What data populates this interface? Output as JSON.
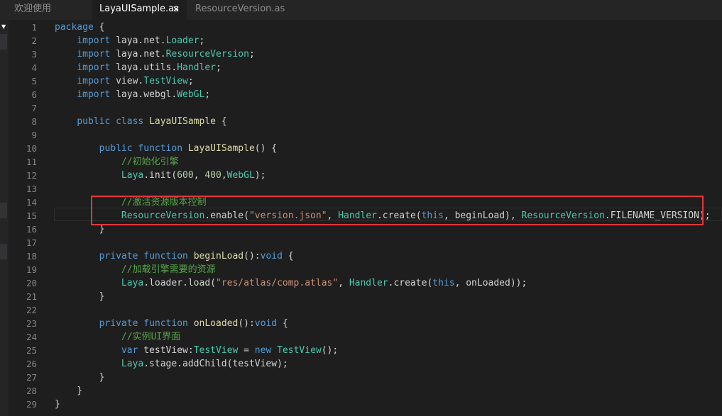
{
  "tabs": [
    {
      "label": "欢迎使用",
      "active": false
    },
    {
      "label": "LayaUISample.as",
      "active": true
    },
    {
      "label": "ResourceVersion.as",
      "active": false
    }
  ],
  "tab_close_glyph": "✕",
  "gutter_arrow": "▼",
  "colors": {
    "background": "#1e1e1e",
    "tab_bar": "#252526",
    "keyword": "#569cd6",
    "type": "#4ec9b0",
    "function": "#dcdcaa",
    "string": "#ce9178",
    "number": "#b5cea8",
    "comment": "#57a64a",
    "highlight_box": "#e2383b"
  },
  "current_line": 15,
  "highlighted_lines": [
    14,
    15
  ],
  "lines": [
    {
      "n": "1",
      "tokens": [
        {
          "t": "kw",
          "v": "package"
        },
        {
          "t": "plain",
          "v": " {"
        }
      ]
    },
    {
      "n": "2",
      "tokens": [
        {
          "t": "plain",
          "v": "    "
        },
        {
          "t": "kw",
          "v": "import"
        },
        {
          "t": "plain",
          "v": " laya.net."
        },
        {
          "t": "type",
          "v": "Loader"
        },
        {
          "t": "plain",
          "v": ";"
        }
      ]
    },
    {
      "n": "3",
      "tokens": [
        {
          "t": "plain",
          "v": "    "
        },
        {
          "t": "kw",
          "v": "import"
        },
        {
          "t": "plain",
          "v": " laya.net."
        },
        {
          "t": "type",
          "v": "ResourceVersion"
        },
        {
          "t": "plain",
          "v": ";"
        }
      ]
    },
    {
      "n": "4",
      "tokens": [
        {
          "t": "plain",
          "v": "    "
        },
        {
          "t": "kw",
          "v": "import"
        },
        {
          "t": "plain",
          "v": " laya.utils."
        },
        {
          "t": "type",
          "v": "Handler"
        },
        {
          "t": "plain",
          "v": ";"
        }
      ]
    },
    {
      "n": "5",
      "tokens": [
        {
          "t": "plain",
          "v": "    "
        },
        {
          "t": "kw",
          "v": "import"
        },
        {
          "t": "plain",
          "v": " view."
        },
        {
          "t": "type",
          "v": "TestView"
        },
        {
          "t": "plain",
          "v": ";"
        }
      ]
    },
    {
      "n": "6",
      "tokens": [
        {
          "t": "plain",
          "v": "    "
        },
        {
          "t": "kw",
          "v": "import"
        },
        {
          "t": "plain",
          "v": " laya.webgl."
        },
        {
          "t": "type",
          "v": "WebGL"
        },
        {
          "t": "plain",
          "v": ";"
        }
      ]
    },
    {
      "n": "7",
      "tokens": []
    },
    {
      "n": "8",
      "tokens": [
        {
          "t": "plain",
          "v": "    "
        },
        {
          "t": "kw",
          "v": "public class"
        },
        {
          "t": "plain",
          "v": " "
        },
        {
          "t": "fn",
          "v": "LayaUISample"
        },
        {
          "t": "plain",
          "v": " {"
        }
      ]
    },
    {
      "n": "9",
      "tokens": []
    },
    {
      "n": "10",
      "tokens": [
        {
          "t": "plain",
          "v": "        "
        },
        {
          "t": "kw",
          "v": "public function"
        },
        {
          "t": "plain",
          "v": " "
        },
        {
          "t": "fn",
          "v": "LayaUISample"
        },
        {
          "t": "plain",
          "v": "() {"
        }
      ]
    },
    {
      "n": "11",
      "tokens": [
        {
          "t": "plain",
          "v": "            "
        },
        {
          "t": "comment",
          "v": "//初始化引擎"
        }
      ]
    },
    {
      "n": "12",
      "tokens": [
        {
          "t": "plain",
          "v": "            "
        },
        {
          "t": "type",
          "v": "Laya"
        },
        {
          "t": "plain",
          "v": ".init("
        },
        {
          "t": "num",
          "v": "600"
        },
        {
          "t": "plain",
          "v": ", "
        },
        {
          "t": "num",
          "v": "400"
        },
        {
          "t": "plain",
          "v": ","
        },
        {
          "t": "type",
          "v": "WebGL"
        },
        {
          "t": "plain",
          "v": ");"
        }
      ]
    },
    {
      "n": "13",
      "tokens": []
    },
    {
      "n": "14",
      "tokens": [
        {
          "t": "plain",
          "v": "            "
        },
        {
          "t": "comment",
          "v": "//激活资源版本控制"
        }
      ]
    },
    {
      "n": "15",
      "tokens": [
        {
          "t": "plain",
          "v": "            "
        },
        {
          "t": "type",
          "v": "ResourceVersion"
        },
        {
          "t": "plain",
          "v": ".enable("
        },
        {
          "t": "str",
          "v": "\"version.json\""
        },
        {
          "t": "plain",
          "v": ", "
        },
        {
          "t": "type",
          "v": "Handler"
        },
        {
          "t": "plain",
          "v": ".create("
        },
        {
          "t": "kw",
          "v": "this"
        },
        {
          "t": "plain",
          "v": ", beginLoad), "
        },
        {
          "t": "type",
          "v": "ResourceVersion"
        },
        {
          "t": "plain",
          "v": ".FILENAME_VERSION);"
        }
      ]
    },
    {
      "n": "16",
      "tokens": [
        {
          "t": "plain",
          "v": "        }"
        }
      ]
    },
    {
      "n": "17",
      "tokens": []
    },
    {
      "n": "18",
      "tokens": [
        {
          "t": "plain",
          "v": "        "
        },
        {
          "t": "kw",
          "v": "private function"
        },
        {
          "t": "plain",
          "v": " "
        },
        {
          "t": "fn",
          "v": "beginLoad"
        },
        {
          "t": "plain",
          "v": "():"
        },
        {
          "t": "kw",
          "v": "void"
        },
        {
          "t": "plain",
          "v": " {"
        }
      ]
    },
    {
      "n": "19",
      "tokens": [
        {
          "t": "plain",
          "v": "            "
        },
        {
          "t": "comment",
          "v": "//加载引擎需要的资源"
        }
      ]
    },
    {
      "n": "20",
      "tokens": [
        {
          "t": "plain",
          "v": "            "
        },
        {
          "t": "type",
          "v": "Laya"
        },
        {
          "t": "plain",
          "v": ".loader.load("
        },
        {
          "t": "str",
          "v": "\"res/atlas/comp.atlas\""
        },
        {
          "t": "plain",
          "v": ", "
        },
        {
          "t": "type",
          "v": "Handler"
        },
        {
          "t": "plain",
          "v": ".create("
        },
        {
          "t": "kw",
          "v": "this"
        },
        {
          "t": "plain",
          "v": ", onLoaded));"
        }
      ]
    },
    {
      "n": "21",
      "tokens": [
        {
          "t": "plain",
          "v": "        }"
        }
      ]
    },
    {
      "n": "22",
      "tokens": []
    },
    {
      "n": "23",
      "tokens": [
        {
          "t": "plain",
          "v": "        "
        },
        {
          "t": "kw",
          "v": "private function"
        },
        {
          "t": "plain",
          "v": " "
        },
        {
          "t": "fn",
          "v": "onLoaded"
        },
        {
          "t": "plain",
          "v": "():"
        },
        {
          "t": "kw",
          "v": "void"
        },
        {
          "t": "plain",
          "v": " {"
        }
      ]
    },
    {
      "n": "24",
      "tokens": [
        {
          "t": "plain",
          "v": "            "
        },
        {
          "t": "comment",
          "v": "//实例UI界面"
        }
      ]
    },
    {
      "n": "25",
      "tokens": [
        {
          "t": "plain",
          "v": "            "
        },
        {
          "t": "kw",
          "v": "var"
        },
        {
          "t": "plain",
          "v": " testView:"
        },
        {
          "t": "type",
          "v": "TestView"
        },
        {
          "t": "plain",
          "v": " = "
        },
        {
          "t": "kw",
          "v": "new"
        },
        {
          "t": "plain",
          "v": " "
        },
        {
          "t": "type",
          "v": "TestView"
        },
        {
          "t": "plain",
          "v": "();"
        }
      ]
    },
    {
      "n": "26",
      "tokens": [
        {
          "t": "plain",
          "v": "            "
        },
        {
          "t": "type",
          "v": "Laya"
        },
        {
          "t": "plain",
          "v": ".stage.addChild(testView);"
        }
      ]
    },
    {
      "n": "27",
      "tokens": [
        {
          "t": "plain",
          "v": "        }"
        }
      ]
    },
    {
      "n": "28",
      "tokens": [
        {
          "t": "plain",
          "v": "    }"
        }
      ]
    },
    {
      "n": "29",
      "tokens": [
        {
          "t": "plain",
          "v": "}"
        }
      ]
    }
  ]
}
